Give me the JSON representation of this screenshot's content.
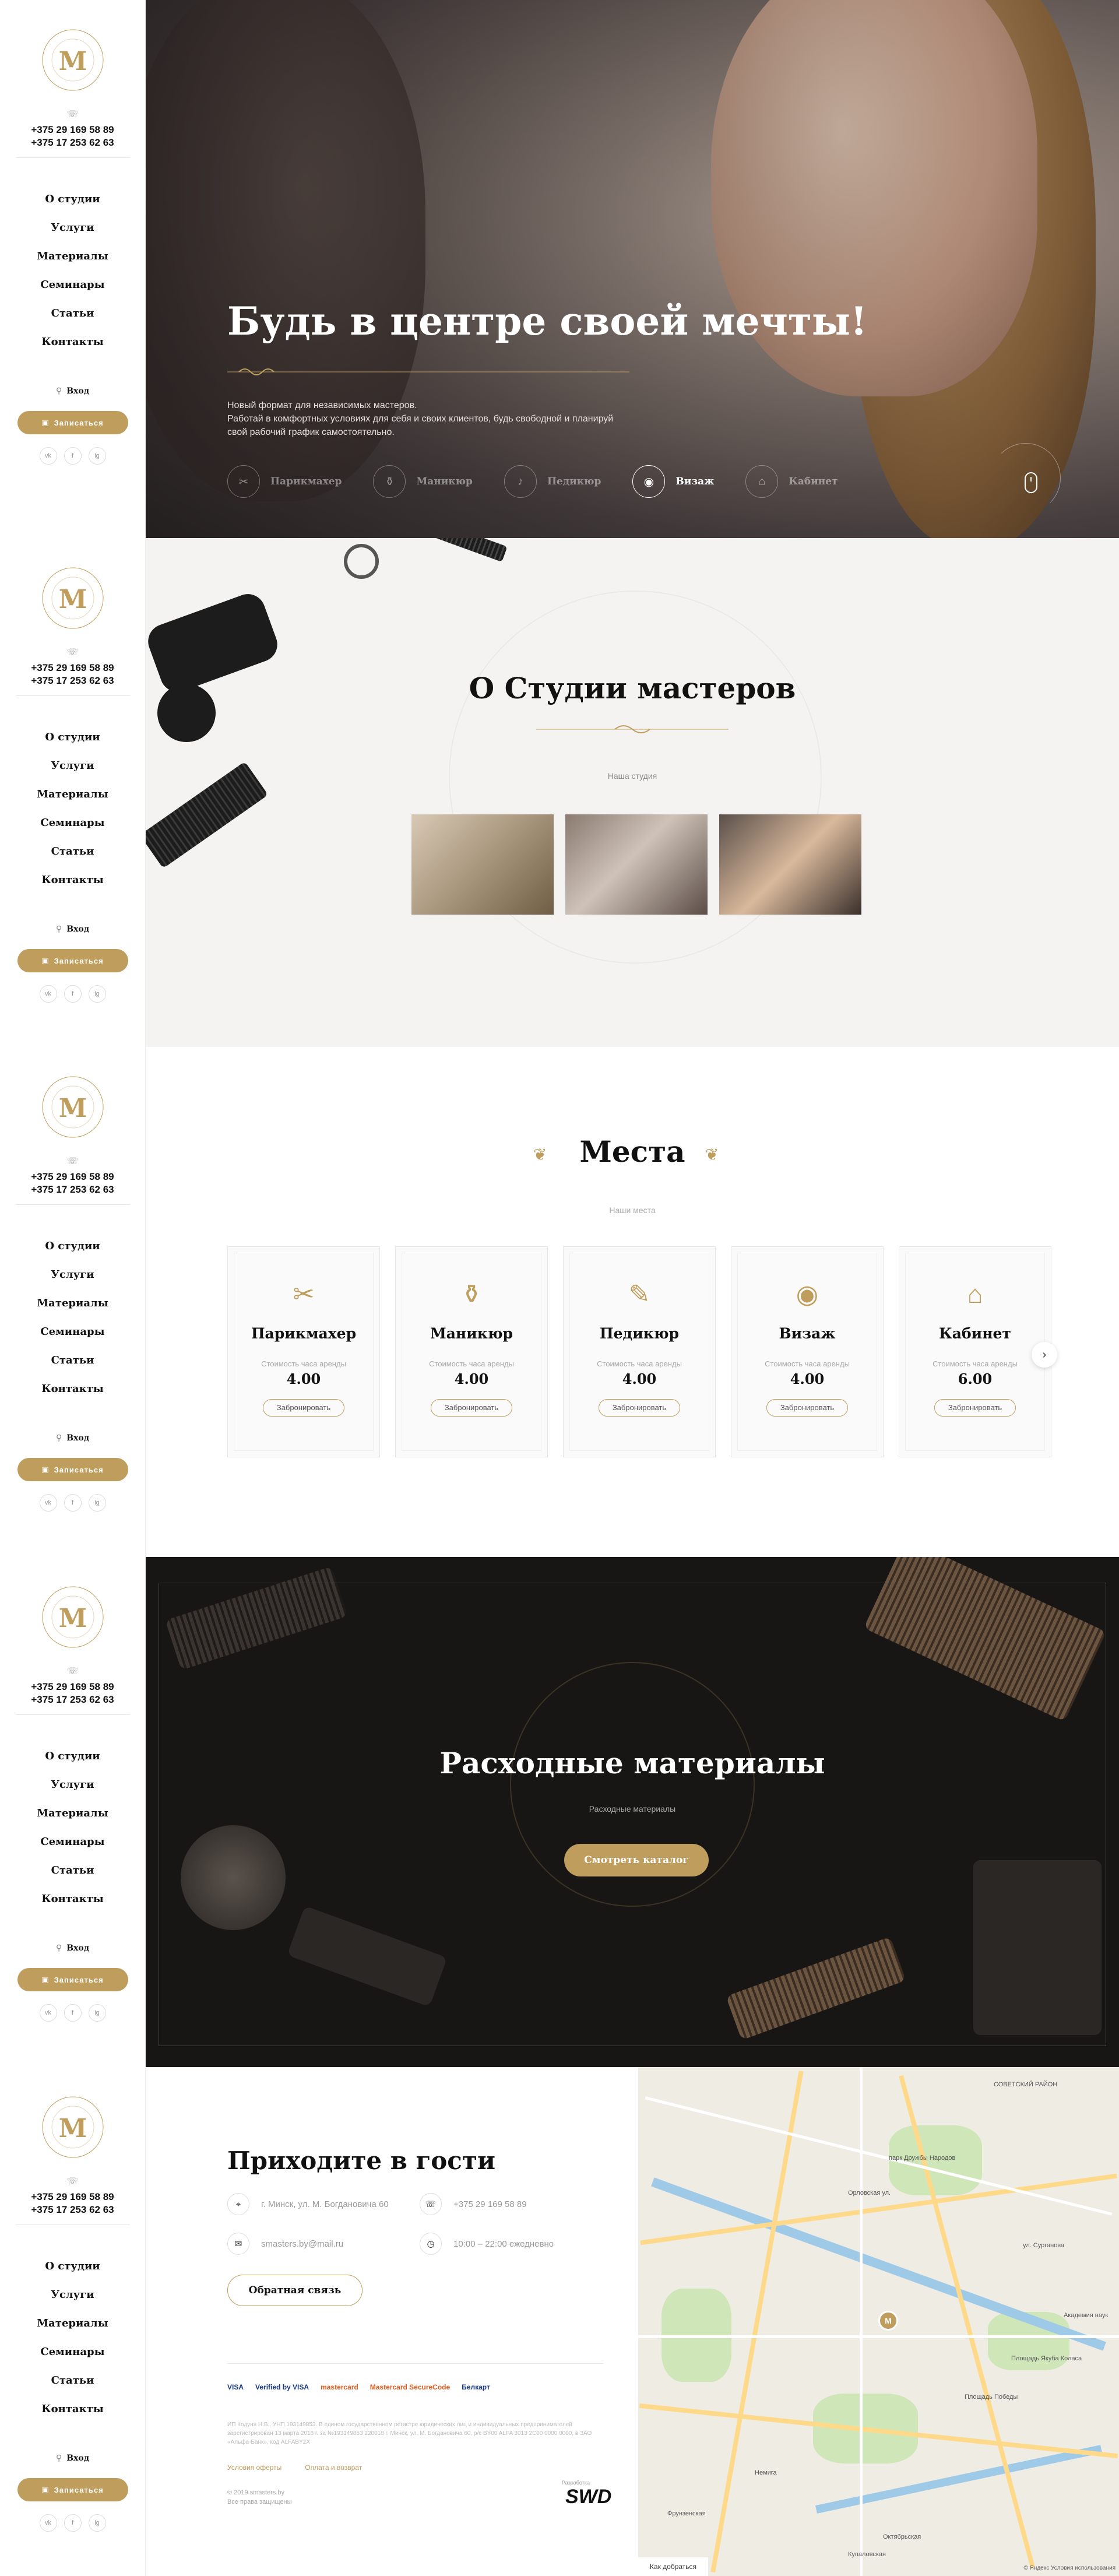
{
  "sidebar": {
    "phones": [
      "+375 29 169 58 89",
      "+375 17 253 62 63"
    ],
    "nav": [
      "О студии",
      "Услуги",
      "Материалы",
      "Семинары",
      "Статьи",
      "Контакты"
    ],
    "login": "Вход",
    "book": "Записаться",
    "socials": [
      "vk",
      "f",
      "ig"
    ]
  },
  "hero": {
    "title": "Будь в центре своей мечты!",
    "subtitle_1": "Новый формат для независимых мастеров.",
    "subtitle_2": "Работай в комфортных условиях для себя и своих клиентов, будь свободной и планируй свой рабочий график самостоятельно.",
    "categories": [
      {
        "label": "Парикмахер",
        "icon": "scissors-icon",
        "active": false
      },
      {
        "label": "Маникюр",
        "icon": "nail-polish-icon",
        "active": false
      },
      {
        "label": "Педикюр",
        "icon": "foot-icon",
        "active": false
      },
      {
        "label": "Визаж",
        "icon": "makeup-icon",
        "active": true
      },
      {
        "label": "Кабинет",
        "icon": "couch-icon",
        "active": false
      }
    ]
  },
  "about": {
    "title": "О Студии мастеров",
    "kicker": "Наша студия"
  },
  "places": {
    "title": "Места",
    "kicker": "Наши места",
    "price_label": "Стоимость часа аренды",
    "book_label": "Забронировать",
    "cards": [
      {
        "name": "Парикмахер",
        "price": "4.00",
        "icon": "scissors-icon"
      },
      {
        "name": "Маникюр",
        "price": "4.00",
        "icon": "nail-polish-icon"
      },
      {
        "name": "Педикюр",
        "price": "4.00",
        "icon": "pedicure-icon"
      },
      {
        "name": "Визаж",
        "price": "4.00",
        "icon": "makeup-icon"
      },
      {
        "name": "Кабинет",
        "price": "6.00",
        "icon": "couch-icon"
      }
    ]
  },
  "supplies": {
    "title": "Расходные материалы",
    "kicker": "Расходные материалы",
    "button": "Смотреть каталог"
  },
  "contacts": {
    "title": "Приходите в гости",
    "address": "г. Минск, ул. М. Богдановича 60",
    "phone": "+375 29 169 58 89",
    "email": "smasters.by@mail.ru",
    "hours": "10:00 – 22:00 ежедневно",
    "feedback": "Обратная связь",
    "payments": [
      "VISA",
      "Verified by VISA",
      "mastercard",
      "Mastercard SecureCode",
      "Белкарт"
    ],
    "legal": "ИП Кодуня Н.В., УНП 193149853. В едином государственном регистре юридических лиц и индивидуальных предпринимателей зарегистрирован 13 марта 2018 г. за №193149853 220018 г. Минск, ул. М. Богдановича 60, р/с BY00 ALFA 3013 2C00 0000 0000, в ЗАО «Альфа-Банк», код ALFABY2X",
    "links": [
      "Условия оферты",
      "Оплата и возврат"
    ],
    "copyright_1": "© 2019 smasters.by",
    "copyright_2": "Все права защищены",
    "dev_label": "Разработка",
    "dev": "SWD"
  },
  "map": {
    "district": "СОВЕТСКИЙ РАЙОН",
    "labels": [
      "Орловская ул.",
      "парк Дружбы Народов",
      "ул. Сурганова",
      "Площадь Победы",
      "Академия наук",
      "Площадь Якуба Коласа",
      "Октябрьская",
      "Купаловская",
      "Фрунзенская",
      "Немига"
    ],
    "route": "Как добраться",
    "provider": "© Яндекс  Условия использования"
  }
}
